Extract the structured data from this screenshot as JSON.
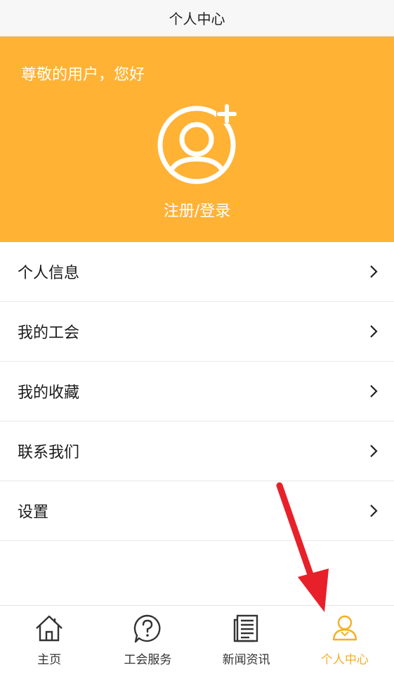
{
  "header": {
    "title": "个人中心"
  },
  "hero": {
    "greeting": "尊敬的用户，您好",
    "login_label": "注册/登录",
    "avatar_icon": "user-add-icon",
    "background_color": "#ffb234"
  },
  "menu": {
    "items": [
      {
        "label": "个人信息"
      },
      {
        "label": "我的工会"
      },
      {
        "label": "我的收藏"
      },
      {
        "label": "联系我们"
      },
      {
        "label": "设置"
      }
    ]
  },
  "tabbar": {
    "tabs": [
      {
        "label": "主页",
        "icon": "home-icon",
        "active": false
      },
      {
        "label": "工会服务",
        "icon": "help-bubble-icon",
        "active": false
      },
      {
        "label": "新闻资讯",
        "icon": "news-icon",
        "active": false
      },
      {
        "label": "个人中心",
        "icon": "person-icon",
        "active": true
      }
    ],
    "active_color": "#f5b021"
  },
  "annotation": {
    "icon": "red-arrow-icon",
    "color": "#e8202a"
  }
}
